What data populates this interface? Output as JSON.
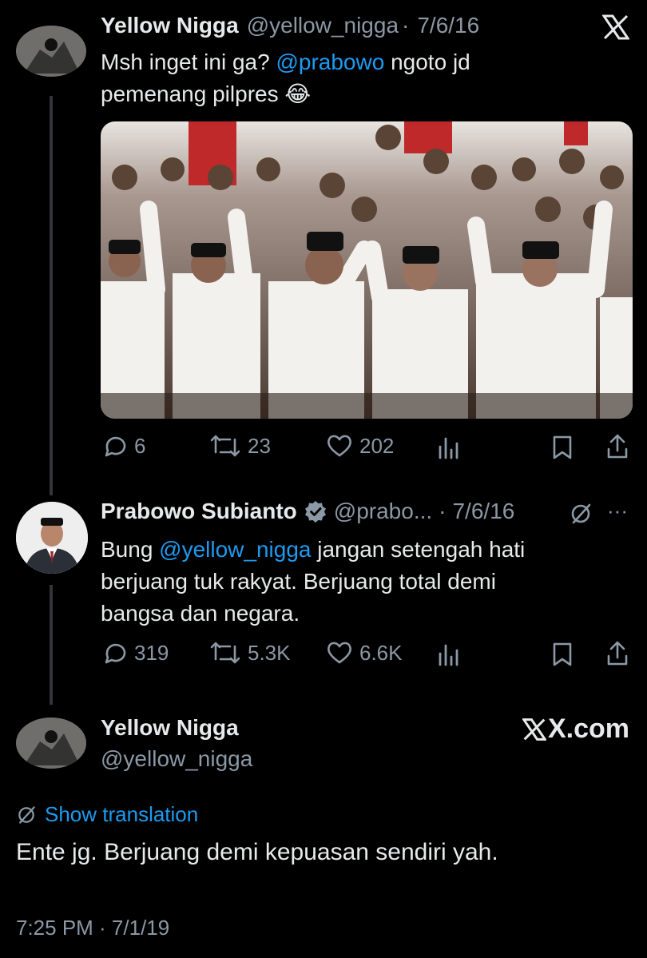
{
  "tweet1": {
    "name": "Yellow Nigga",
    "handle": "@yellow_nigga",
    "dot": "·",
    "date": "7/6/16",
    "text_prefix": "Msh inget ini ga? ",
    "mention": "@prabowo",
    "text_suffix": " ngoto jd",
    "text_line2": "pemenang pilpres",
    "emoji": "😂",
    "stats": {
      "replies": "6",
      "retweets": "23",
      "likes": "202"
    }
  },
  "tweet2": {
    "name": "Prabowo Subianto",
    "handle": "@prabo...",
    "dot": "·",
    "date": "7/6/16",
    "more": "···",
    "line1_prefix": "Bung ",
    "mention": "@yellow_nigga",
    "line1_suffix": " jangan setengah hati",
    "line2": "berjuang tuk rakyat. Berjuang total demi",
    "line3": "bangsa dan negara.",
    "stats": {
      "replies": "319",
      "retweets": "5.3K",
      "likes": "6.6K"
    }
  },
  "tweet3": {
    "name": "Yellow Nigga",
    "handle": "@yellow_nigga",
    "brand": "X.com",
    "translate_label": "Show translation",
    "text": "Ente jg. Berjuang demi kepuasan sendiri yah.",
    "timestamp": "7:25 PM · 7/1/19"
  },
  "icons": {
    "close": "x-logo-icon",
    "reply": "reply-icon",
    "retweet": "retweet-icon",
    "like": "heart-icon",
    "views": "views-icon",
    "bookmark": "bookmark-icon",
    "share": "share-icon",
    "verified": "verified-badge-icon",
    "translate": "translate-icon"
  },
  "colors": {
    "background": "#000000",
    "text": "#e7e9ea",
    "muted": "#8b98a5",
    "link": "#1d9bf0"
  }
}
